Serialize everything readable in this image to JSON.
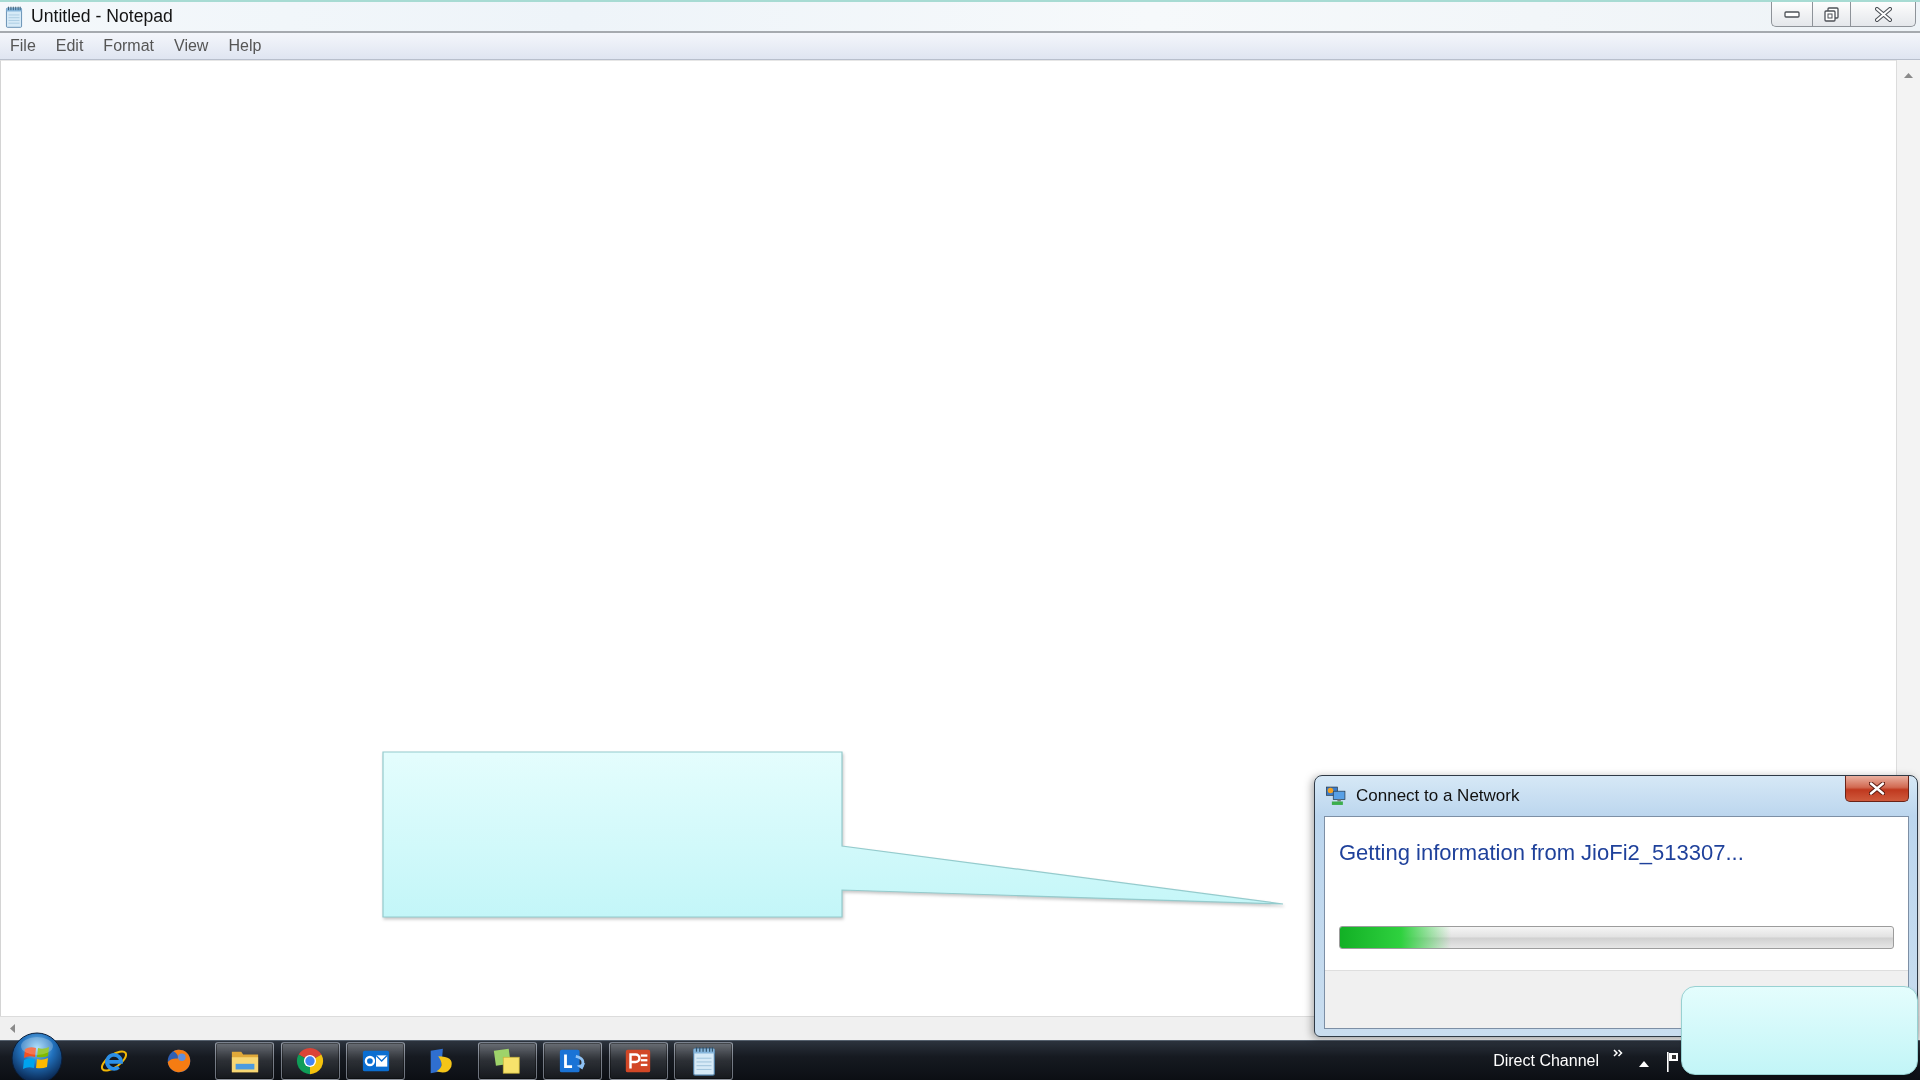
{
  "window": {
    "title": "Untitled - Notepad"
  },
  "menu_bar": [
    "File",
    "Edit",
    "Format",
    "View",
    "Help"
  ],
  "dialog": {
    "title": "Connect to a Network",
    "message": "Getting information from JioFi2_513307...",
    "progress": {
      "level": 0.2
    }
  },
  "taskbar": {
    "apps": [
      {
        "running": false
      },
      {
        "running": false
      },
      {
        "running": true
      },
      {
        "running": true
      },
      {
        "running": true
      },
      {
        "running": false
      },
      {
        "running": true
      },
      {
        "running": true
      },
      {
        "running": true
      },
      {
        "running": true
      }
    ],
    "toolbar_label": "Direct Channel"
  }
}
